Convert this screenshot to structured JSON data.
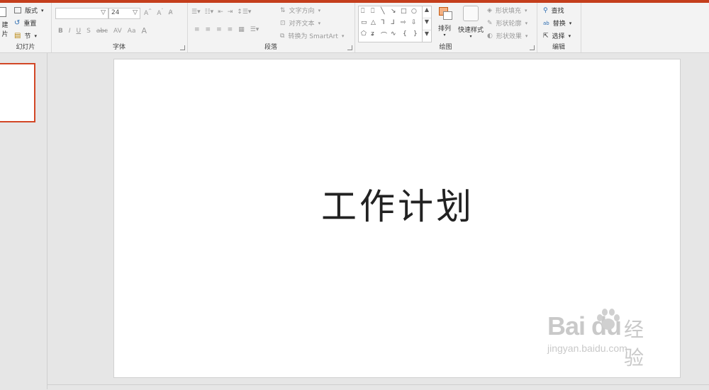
{
  "ribbon": {
    "slides_group": {
      "label": "幻灯片",
      "new_slide_line1": "建",
      "new_slide_line2": "片",
      "layout": "版式",
      "reset": "重置",
      "section": "节"
    },
    "font_group": {
      "label": "字体",
      "font_name": "",
      "font_size": "24",
      "bold": "B",
      "italic": "I",
      "underline": "U",
      "shadow": "S",
      "strike": "abc",
      "spacing": "AV",
      "case": "Aa",
      "color": "A"
    },
    "paragraph_group": {
      "label": "段落",
      "text_direction": "文字方向",
      "align_text": "对齐文本",
      "smartart": "转换为 SmartArt"
    },
    "drawing_group": {
      "label": "绘图",
      "arrange": "排列",
      "quick_styles": "快速样式",
      "shape_fill": "形状填充",
      "shape_outline": "形状轮廓",
      "shape_effects": "形状效果"
    },
    "editing_group": {
      "label": "编辑",
      "find": "查找",
      "replace": "替换",
      "select": "选择"
    }
  },
  "slide": {
    "title": "工作计划"
  },
  "watermark": {
    "logo": "Bai du",
    "cn": "经验",
    "url": "jingyan.baidu.com"
  },
  "colors": {
    "accent": "#c43e1c",
    "thumb_border": "#d24726"
  }
}
